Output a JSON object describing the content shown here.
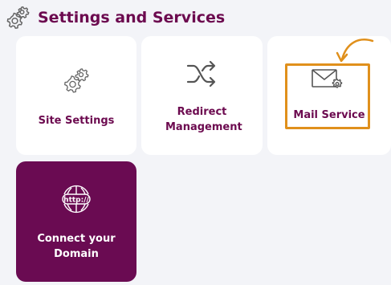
{
  "header": {
    "title": "Settings and Services",
    "icon": "gears-icon"
  },
  "tiles": [
    {
      "label": "Site Settings",
      "icon": "gears-icon",
      "active": false
    },
    {
      "label": "Redirect Management",
      "icon": "shuffle-arrows-icon",
      "active": false
    },
    {
      "label": "Mail Service",
      "icon": "mail-settings-icon",
      "active": false,
      "highlighted": true
    },
    {
      "label": "Connect your Domain",
      "icon": "http-globe-icon",
      "active": true
    }
  ],
  "colors": {
    "brand": "#6c0a4f",
    "active_tile": "#6a0b52",
    "highlight": "#e0901c",
    "background": "#f3f4f8",
    "tile": "#ffffff"
  }
}
